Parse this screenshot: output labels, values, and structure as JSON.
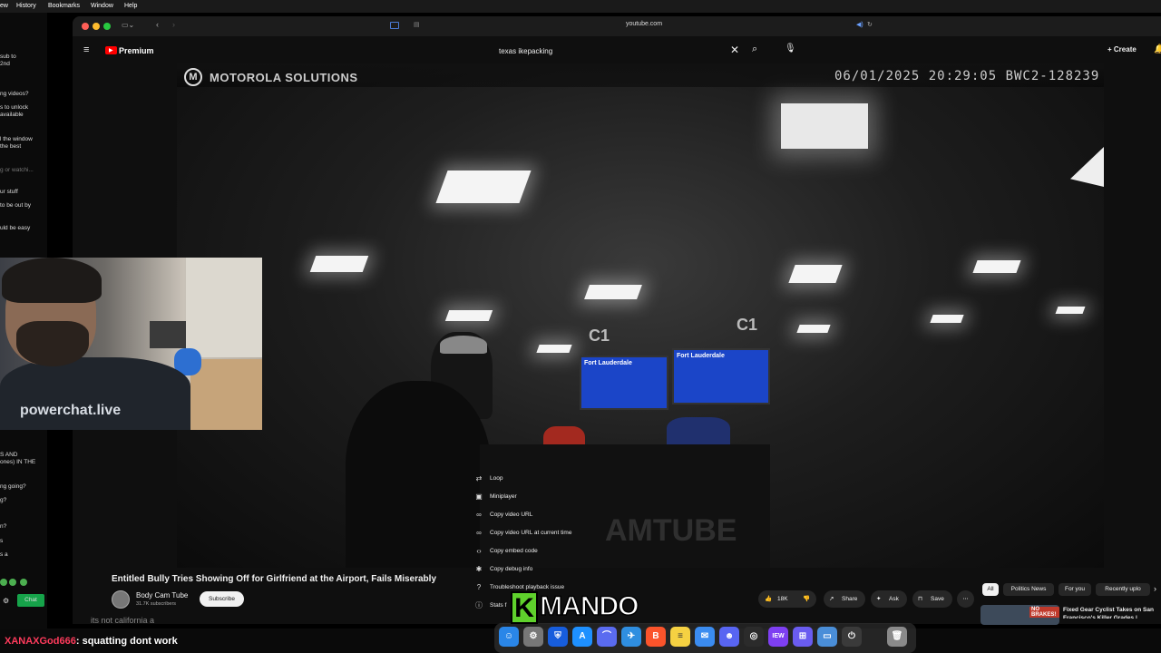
{
  "menubar": {
    "items": [
      "ew",
      "History",
      "Bookmarks",
      "Window",
      "Help"
    ]
  },
  "chat_panel": {
    "messages": [
      "sub to\n2nd",
      "ng videos?",
      "s to unlock\navailable",
      "l the window\n the best",
      "g or watchi...",
      "ur stuff",
      "to be out by",
      "uld be easy",
      "S AND\nones) IN THE",
      "ng going?",
      "g?",
      "n?",
      "s",
      "s a"
    ],
    "chat_button": "Chat"
  },
  "browser": {
    "url": "youtube.com",
    "logo_text": "Premium",
    "search_value": "texas ikepacking",
    "create_label": "Create"
  },
  "video": {
    "brand": "MOTOROLA SOLUTIONS",
    "timestamp": "06/01/2025 20:29:05 BWC2-128239",
    "gate_left": "C1",
    "gate_right": "C1",
    "screen_left": "Fort Lauderdale",
    "screen_right": "Fort Lauderdale",
    "watermark": "AMTUBE"
  },
  "context_menu": {
    "items": [
      {
        "label": "Loop",
        "icon": "loop-icon"
      },
      {
        "label": "Miniplayer",
        "icon": "miniplayer-icon"
      },
      {
        "label": "Copy video URL",
        "icon": "link-icon"
      },
      {
        "label": "Copy video URL at current time",
        "icon": "link-icon"
      },
      {
        "label": "Copy embed code",
        "icon": "code-icon"
      },
      {
        "label": "Copy debug info",
        "icon": "bug-icon"
      },
      {
        "label": "Troubleshoot playback issue",
        "icon": "help-icon"
      },
      {
        "label": "Stats f",
        "icon": "info-icon"
      }
    ]
  },
  "video_info": {
    "title": "Entitled Bully Tries Showing Off for Girlfriend at the Airport, Fails Miserably",
    "channel": "Body Cam Tube",
    "subscribers": "31.7K subscribers",
    "subscribe_label": "Subscribe",
    "likes": "18K",
    "share_label": "Share",
    "ask_label": "Ask",
    "save_label": "Save",
    "comment_snippet": "its not california a"
  },
  "chips": [
    "All",
    "Politics News",
    "For you",
    "Recently uplo"
  ],
  "recommendation": {
    "title": "Fixed Gear Cyclist Takes on San Francisco's Killer Grades |",
    "thumb_text": "NO BRAKES!"
  },
  "webcam": {
    "shirt_text": "powerchat.live"
  },
  "chat_line": {
    "user": "XANAXGod666",
    "text": ": squatting dont work",
    "user_color": "#ff3b5c"
  },
  "overlay": {
    "logo_text": "MANDO",
    "logo_letter": "K"
  },
  "dock": {
    "apps": [
      "finder-icon",
      "settings-icon",
      "bitwarden-icon",
      "app-store-icon",
      "arc-icon",
      "safari-icon",
      "brave-icon",
      "notes-icon",
      "mail-icon",
      "discord-icon",
      "activity-icon",
      "iew-icon",
      "grid-icon",
      "screenshot-icon",
      "power-icon",
      "trash-icon"
    ]
  }
}
